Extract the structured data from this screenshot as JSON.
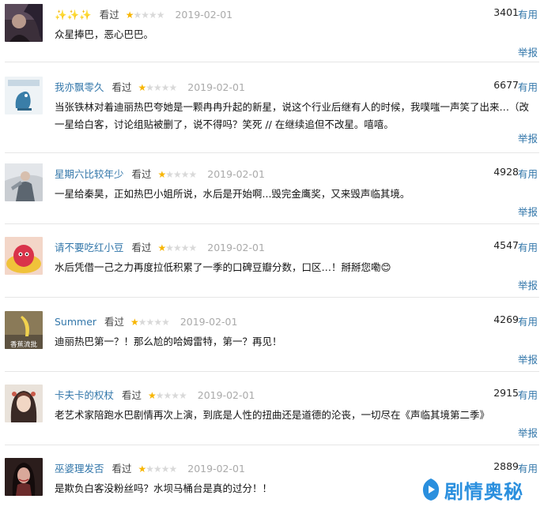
{
  "reviews": [
    {
      "user": "✨✨✨",
      "watched": "看过",
      "rating": 1,
      "date": "2019-02-01",
      "votes": "3401",
      "useful": "有用",
      "comment": "众星捧巴，恶心巴巴。",
      "report": "举报",
      "avatar_icon": "dark-portrait-avatar"
    },
    {
      "user": "我亦飘零久",
      "watched": "看过",
      "rating": 1,
      "date": "2019-02-01",
      "votes": "6677",
      "useful": "有用",
      "comment": "当张铁林对着迪丽热巴夸她是一颗冉冉升起的新星，说这个行业后继有人的时候，我噗嗤一声笑了出来…（改一星给白客，讨论组贴被删了，说不得吗？笑死 // 在继续追但不改星。嘻嘻。",
      "report": "举报",
      "avatar_icon": "cartoon-dinosaur-avatar"
    },
    {
      "user": "星期六比较年少",
      "watched": "看过",
      "rating": 1,
      "date": "2019-02-01",
      "votes": "4928",
      "useful": "有用",
      "comment": "一星给秦昊，正如热巴小姐所说，水后是开始啊...毁完金鹰奖，又来毁声临其境。",
      "report": "举报",
      "avatar_icon": "costume-figure-avatar"
    },
    {
      "user": "请不要吃红小豆",
      "watched": "看过",
      "rating": 1,
      "date": "2019-02-01",
      "votes": "4547",
      "useful": "有用",
      "comment": "水后凭借一己之力再度拉低积累了一季的口碑豆瓣分数，口区…！掰掰您嘞😊",
      "report": "举报",
      "avatar_icon": "red-bean-cartoon-avatar"
    },
    {
      "user": "Summer",
      "watched": "看过",
      "rating": 1,
      "date": "2019-02-01",
      "votes": "4269",
      "useful": "有用",
      "comment": "迪丽热巴第一？！那么尬的哈姆雷特，第一？再见！",
      "report": "举报",
      "avatar_icon": "banana-photo-avatar",
      "avatar_text": "香蕉流批"
    },
    {
      "user": "卡夫卡的权杖",
      "watched": "看过",
      "rating": 1,
      "date": "2019-02-01",
      "votes": "2915",
      "useful": "有用",
      "comment": "老艺术家陪跑水巴剧情再次上演，到底是人性的扭曲还是道德的沦丧，一切尽在《声临其境第二季》",
      "report": "举报",
      "avatar_icon": "illustrated-girl-avatar"
    },
    {
      "user": "巫婆理发否",
      "watched": "看过",
      "rating": 1,
      "date": "2019-02-01",
      "votes": "2889",
      "useful": "有用",
      "comment": "是欺负白客没粉丝吗？水坝马桶台是真的过分！！",
      "report": "",
      "avatar_icon": "woman-portrait-avatar"
    }
  ],
  "watermark": {
    "text": "剧情奥秘",
    "icon": "play-logo-icon"
  },
  "colors": {
    "link": "#3377aa",
    "star_on": "#f7b500",
    "star_off": "#d9d9d9",
    "date": "#aaaaaa"
  }
}
